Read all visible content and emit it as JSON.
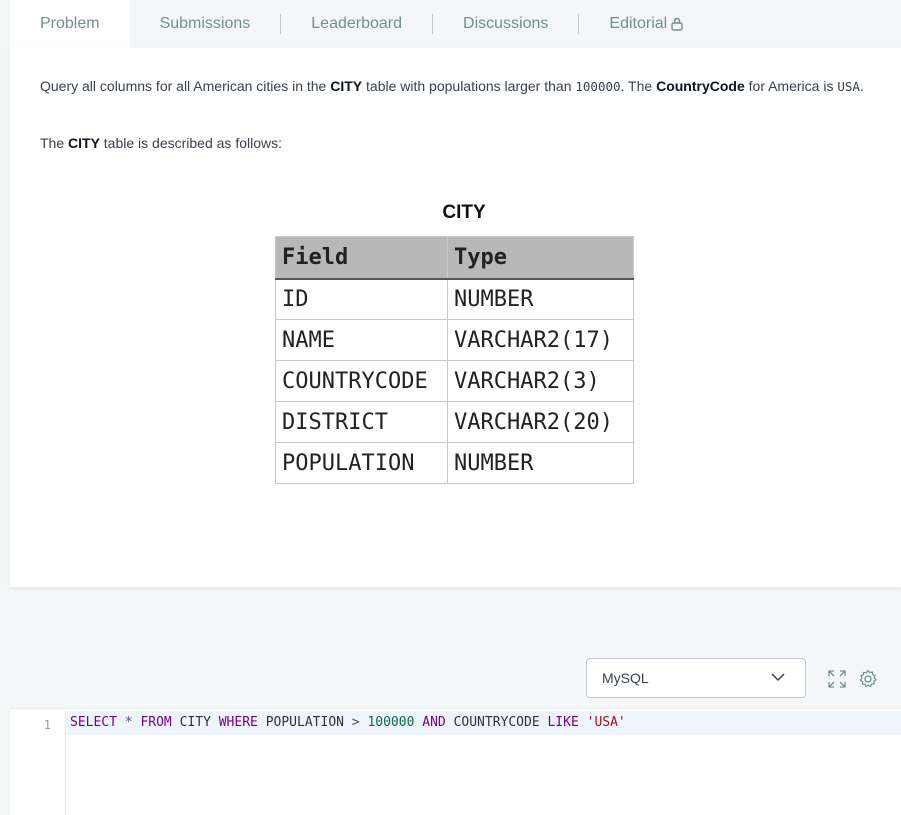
{
  "tabs": [
    {
      "label": "Problem",
      "active": true
    },
    {
      "label": "Submissions"
    },
    {
      "label": "Leaderboard"
    },
    {
      "label": "Discussions"
    },
    {
      "label": "Editorial",
      "icon": "lock-icon"
    }
  ],
  "problem": {
    "p1_a": "Query all columns for all American cities in the ",
    "p1_b": "CITY",
    "p1_c": " table with populations larger than ",
    "p1_d": "100000",
    "p1_e": ". The ",
    "p1_f": "CountryCode",
    "p1_g": " for America is ",
    "p1_h": "USA",
    "p1_i": ".",
    "p2_a": "The ",
    "p2_b": "CITY",
    "p2_c": " table is described as follows:",
    "table_title": "CITY",
    "table_headers": [
      "Field",
      "Type"
    ],
    "table_rows": [
      [
        "ID",
        "NUMBER"
      ],
      [
        "NAME",
        "VARCHAR2(17)"
      ],
      [
        "COUNTRYCODE",
        "VARCHAR2(3)"
      ],
      [
        "DISTRICT",
        "VARCHAR2(20)"
      ],
      [
        "POPULATION",
        "NUMBER"
      ]
    ]
  },
  "editor": {
    "language": "MySQL",
    "line_number": "1",
    "code": {
      "t1": "SELECT",
      "t2": " * ",
      "t3": "FROM",
      "t4": " CITY ",
      "t5": "WHERE",
      "t6": " POPULATION ",
      "t7": ">",
      "t8": " ",
      "t9": "100000",
      "t10": " ",
      "t11": "AND",
      "t12": " COUNTRYCODE ",
      "t13": "LIKE",
      "t14": " ",
      "t15": "'USA'"
    }
  }
}
